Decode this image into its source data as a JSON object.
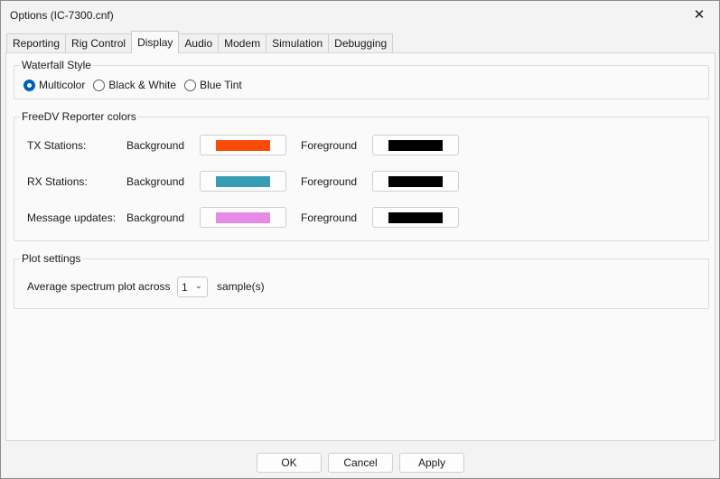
{
  "window": {
    "title": "Options (IC-7300.cnf)",
    "close_glyph": "✕"
  },
  "tabs": [
    {
      "label": "Reporting"
    },
    {
      "label": "Rig Control"
    },
    {
      "label": "Display",
      "active": true
    },
    {
      "label": "Audio"
    },
    {
      "label": "Modem"
    },
    {
      "label": "Simulation"
    },
    {
      "label": "Debugging"
    }
  ],
  "waterfall": {
    "title": "Waterfall Style",
    "options": [
      {
        "label": "Multicolor",
        "checked": true
      },
      {
        "label": "Black & White",
        "checked": false
      },
      {
        "label": "Blue Tint",
        "checked": false
      }
    ]
  },
  "reporter_colors": {
    "title": "FreeDV Reporter colors",
    "background_label": "Background",
    "foreground_label": "Foreground",
    "rows": [
      {
        "label": "TX Stations:",
        "background": "#fc4b08",
        "foreground": "#000000"
      },
      {
        "label": "RX Stations:",
        "background": "#379cb4",
        "foreground": "#000000"
      },
      {
        "label": "Message updates:",
        "background": "#e68ae6",
        "foreground": "#000000"
      }
    ]
  },
  "plot": {
    "title": "Plot settings",
    "label": "Average spectrum plot across",
    "value": "1",
    "unit": "sample(s)"
  },
  "buttons": {
    "ok": "OK",
    "cancel": "Cancel",
    "apply": "Apply"
  }
}
